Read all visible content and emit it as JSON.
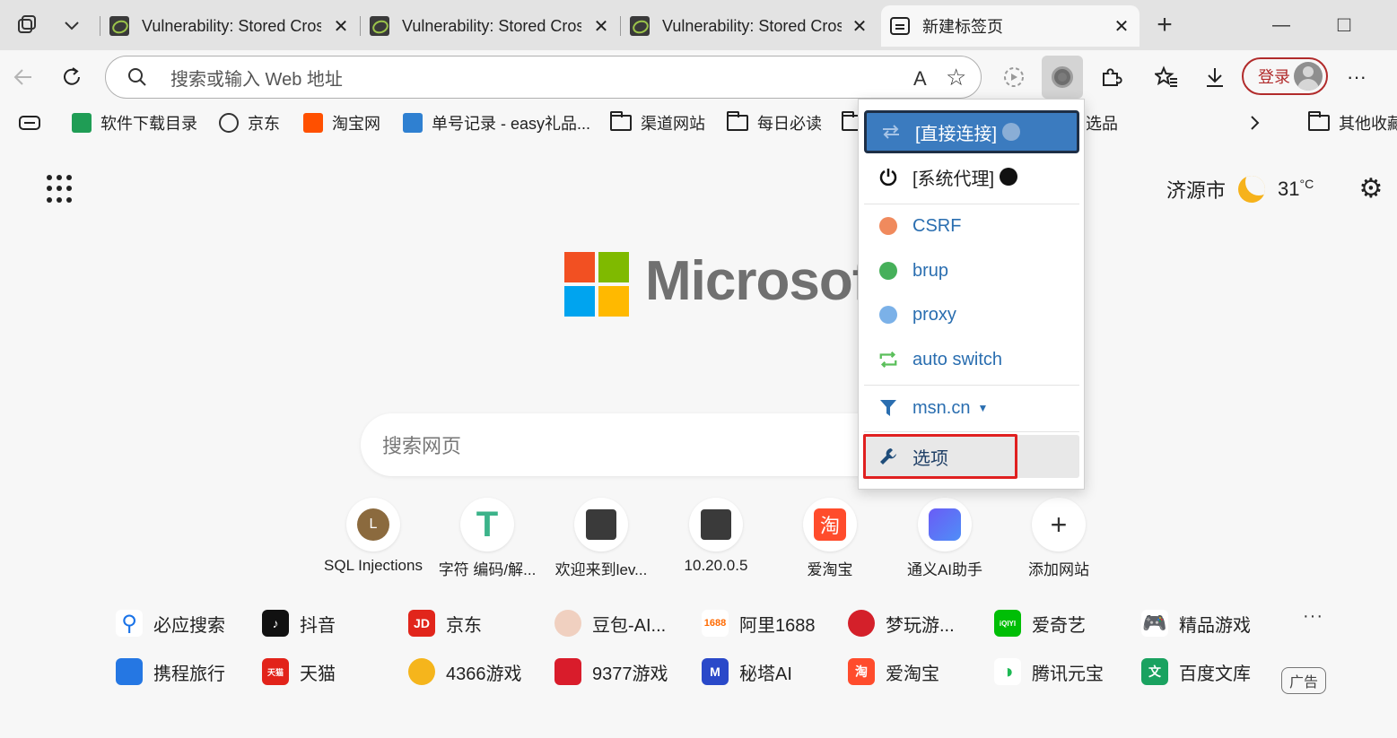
{
  "tabs": [
    {
      "title": "Vulnerability: Stored Cros",
      "close": "✕"
    },
    {
      "title": "Vulnerability: Stored Cros",
      "close": "✕"
    },
    {
      "title": "Vulnerability: Stored Cros",
      "close": "✕"
    },
    {
      "title": "新建标签页",
      "close": "✕",
      "active": true
    }
  ],
  "tabstrip": {
    "new_tab": "+",
    "minimize": "—",
    "maximize": "□"
  },
  "omnibox": {
    "placeholder": "搜索或输入 Web 地址",
    "read_aloud": "A",
    "favorite": "☆"
  },
  "toolbar": {
    "login_label": "登录",
    "more": "···"
  },
  "bookmarks": [
    {
      "label": "软件下载目录",
      "icon": "sheet-icon",
      "color": "#1f9d55"
    },
    {
      "label": "京东",
      "icon": "globe-icon",
      "color": "#333333"
    },
    {
      "label": "淘宝网",
      "icon": "taobao-icon",
      "color": "#ff5000"
    },
    {
      "label": "单号记录 - easy礼品...",
      "icon": "gift-icon",
      "color": "#2f80d1"
    },
    {
      "label": "渠道网站",
      "icon": "folder-icon"
    },
    {
      "label": "每日必读",
      "icon": "folder-icon"
    },
    {
      "label": "选品",
      "icon": "folder-icon"
    },
    {
      "label": "其他收藏",
      "icon": "folder-icon"
    }
  ],
  "weather": {
    "city": "济源市",
    "temp": "31",
    "unit": "°C"
  },
  "brand": {
    "word": "Microsoft"
  },
  "websearch": {
    "placeholder": "搜索网页"
  },
  "tiles": [
    {
      "label": "SQL Injections",
      "letter": "L"
    },
    {
      "label": "字符 编码/解...",
      "letter": "T"
    },
    {
      "label": "欢迎来到lev..."
    },
    {
      "label": "10.20.0.5"
    },
    {
      "label": "爱淘宝",
      "letter": "淘"
    },
    {
      "label": "通义AI助手"
    },
    {
      "label": "添加网站",
      "letter": "+"
    }
  ],
  "quicklinks_row1": [
    {
      "label": "必应搜索",
      "icon": "bing-search-icon",
      "color": "#1a73e8"
    },
    {
      "label": "抖音",
      "icon": "douyin-icon",
      "color": "#111111"
    },
    {
      "label": "京东",
      "icon": "jd-icon",
      "color": "#e1251b",
      "mark": "JD"
    },
    {
      "label": "豆包-AI...",
      "icon": "doubao-icon",
      "color": "#f0d0c0"
    },
    {
      "label": "阿里1688",
      "icon": "alibaba-1688-icon",
      "color": "#ff6a00",
      "mark": "1688"
    },
    {
      "label": "梦玩游...",
      "icon": "game-icon",
      "color": "#d4202a"
    },
    {
      "label": "爱奇艺",
      "icon": "iqiyi-icon",
      "color": "#00be06",
      "mark": "iQIYI"
    },
    {
      "label": "精品游戏",
      "icon": "gamepad-icon",
      "color": "#7b4be8"
    }
  ],
  "quicklinks_row2": [
    {
      "label": "携程旅行",
      "icon": "ctrip-icon",
      "color": "#2577e3"
    },
    {
      "label": "天猫",
      "icon": "tmall-icon",
      "color": "#e2231a",
      "mark": "天猫"
    },
    {
      "label": "4366游戏",
      "icon": "cat-game-icon",
      "color": "#f5b51c"
    },
    {
      "label": "9377游戏",
      "icon": "9377-icon",
      "color": "#d91c2b"
    },
    {
      "label": "秘塔AI",
      "icon": "metaso-icon",
      "color": "#2a49c9",
      "mark": "M"
    },
    {
      "label": "爱淘宝",
      "icon": "aitaobao-icon",
      "color": "#ff4c2c",
      "mark": "淘"
    },
    {
      "label": "腾讯元宝",
      "icon": "yuanbao-icon",
      "color": "#1db954"
    },
    {
      "label": "百度文库",
      "icon": "wenku-icon",
      "color": "#1aa260",
      "mark": "文"
    }
  ],
  "ad_label": "广告",
  "more_dots": "···",
  "popup": {
    "items": [
      {
        "label": "[直接连接]",
        "icon": "direct-connect-icon",
        "selected": true
      },
      {
        "label": "[系统代理]",
        "icon": "power-icon"
      },
      {
        "label": "CSRF",
        "icon": "globe-orange-icon",
        "color": "#f08a5d"
      },
      {
        "label": "brup",
        "icon": "globe-green-icon",
        "color": "#46b05a"
      },
      {
        "label": "proxy",
        "icon": "globe-blue-icon",
        "color": "#7bb1e8"
      },
      {
        "label": "auto switch",
        "icon": "auto-switch-icon",
        "color": "#5bbf5b"
      },
      {
        "label": "msn.cn",
        "icon": "filter-icon",
        "color": "#2a6eb0"
      },
      {
        "label": "选项",
        "icon": "wrench-icon",
        "color": "#2a6eb0"
      }
    ]
  },
  "colors": {
    "accent": "#3b7bbf",
    "highlight": "#e02020",
    "login": "#b12b2b"
  }
}
